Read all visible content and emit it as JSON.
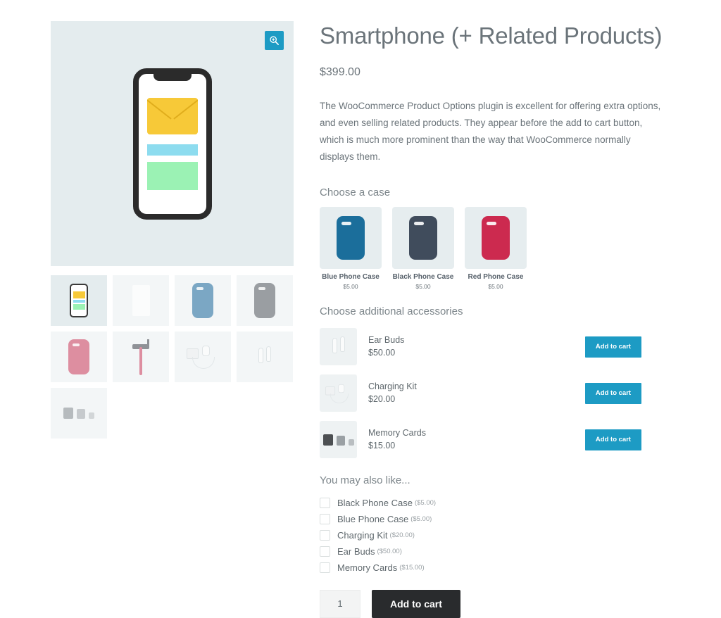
{
  "gallery": {
    "zoom_icon": "magnifier-plus-icon",
    "main_image_alt": "Smartphone with envelope on screen",
    "thumbnails": [
      {
        "name": "smartphone-front",
        "selected": true
      },
      {
        "name": "screen-protector",
        "selected": false
      },
      {
        "name": "blue-phone-case",
        "selected": false
      },
      {
        "name": "grey-phone-case",
        "selected": false
      },
      {
        "name": "pink-phone-case",
        "selected": false
      },
      {
        "name": "selfie-stick",
        "selected": false
      },
      {
        "name": "charging-kit",
        "selected": false
      },
      {
        "name": "ear-buds",
        "selected": false
      },
      {
        "name": "memory-cards",
        "selected": false
      }
    ]
  },
  "product": {
    "title": "Smartphone (+ Related Products)",
    "price": "$399.00",
    "description": "The WooCommerce Product Options plugin is excellent for offering extra options, and even selling related products. They appear before the add to cart button, which is much more prominent than the way that WooCommerce normally displays them."
  },
  "case_section": {
    "heading": "Choose a case",
    "options": [
      {
        "label": "Blue Phone Case",
        "price": "$5.00",
        "color": "#1b6e9b"
      },
      {
        "label": "Black Phone Case",
        "price": "$5.00",
        "color": "#404c5c"
      },
      {
        "label": "Red Phone Case",
        "price": "$5.00",
        "color": "#cc2a4f"
      }
    ]
  },
  "accessories_section": {
    "heading": "Choose additional accessories",
    "items": [
      {
        "name": "Ear Buds",
        "price": "$50.00",
        "button": "Add to cart",
        "icon": "ear-buds-icon"
      },
      {
        "name": "Charging Kit",
        "price": "$20.00",
        "button": "Add to cart",
        "icon": "charging-kit-icon"
      },
      {
        "name": "Memory Cards",
        "price": "$15.00",
        "button": "Add to cart",
        "icon": "memory-cards-icon"
      }
    ]
  },
  "also_like_section": {
    "heading": "You may also like...",
    "items": [
      {
        "label": "Black Phone Case",
        "price": "($5.00)",
        "checked": false
      },
      {
        "label": "Blue Phone Case",
        "price": "($5.00)",
        "checked": false
      },
      {
        "label": "Charging Kit",
        "price": "($20.00)",
        "checked": false
      },
      {
        "label": "Ear Buds",
        "price": "($50.00)",
        "checked": false
      },
      {
        "label": "Memory Cards",
        "price": "($15.00)",
        "checked": false
      }
    ]
  },
  "cart": {
    "quantity": "1",
    "add_to_cart_label": "Add to cart"
  },
  "colors": {
    "accent_blue": "#1d9bc4",
    "cart_dark": "#292b2d",
    "image_bg": "#e4ecee",
    "tile_bg": "#e6edef"
  }
}
